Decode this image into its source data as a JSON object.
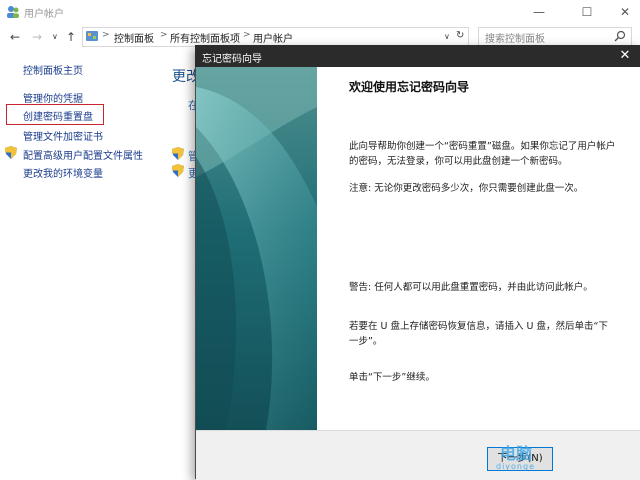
{
  "window": {
    "title": "用户帐户",
    "controls": {
      "minimize": "—",
      "maximize": "☐",
      "close": "✕"
    }
  },
  "nav": {
    "back": "←",
    "forward": "→",
    "dropdown": "∨",
    "up": "↑",
    "breadcrumbs": [
      "控制面板",
      "所有控制面板项",
      "用户帐户"
    ],
    "separator": ">",
    "refresh": "↻",
    "search_placeholder": "搜索控制面板"
  },
  "sidebar": {
    "items": [
      {
        "label": "控制面板主页"
      },
      {
        "label": "管理你的凭据"
      },
      {
        "label": "创建密码重置盘"
      },
      {
        "label": "管理文件加密证书"
      },
      {
        "label": "配置高级用户配置文件属性"
      },
      {
        "label": "更改我的环境变量"
      }
    ]
  },
  "main": {
    "heading_fragment": "更改",
    "link_fragments": [
      "在",
      "管",
      "更"
    ]
  },
  "wizard": {
    "title": "忘记密码向导",
    "close": "✕",
    "heading": "欢迎使用忘记密码向导",
    "paragraphs": [
      "此向导帮助你创建一个“密码重置”磁盘。如果你忘记了用户帐户的密码，无法登录，你可以用此盘创建一个新密码。",
      "注意: 无论你更改密码多少次，你只需要创建此盘一次。",
      "警告: 任何人都可以用此盘重置密码，并由此访问此帐户。",
      "若要在 U 盘上存储密码恢复信息，请插入 U 盘，然后单击“下一步”。",
      "单击“下一步”继续。"
    ],
    "next_label": "下一步(N)"
  },
  "watermark": {
    "text": "电脑",
    "sub": "diyonge"
  },
  "colors": {
    "accent": "#0078d7",
    "highlight": "#c9252c",
    "link": "#1b3d8c",
    "banner": "#1e6f7a"
  }
}
